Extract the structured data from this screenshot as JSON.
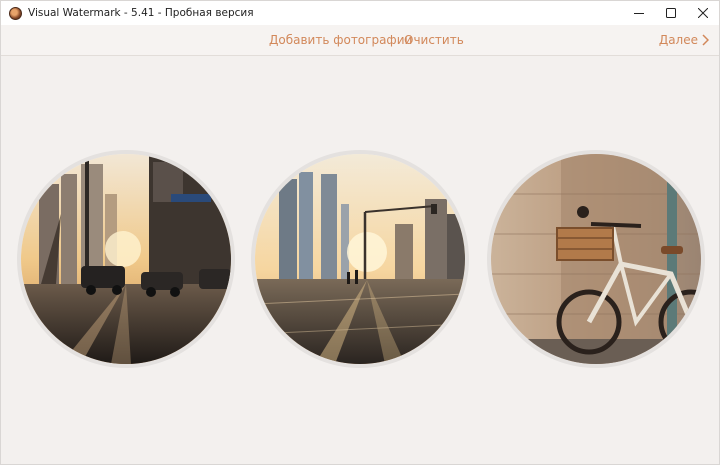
{
  "window": {
    "title": "Visual Watermark - 5.41 - Пробная версия",
    "icons": {
      "app": "app-icon",
      "minimize": "minimize-icon",
      "maximize": "maximize-icon",
      "close": "close-icon"
    }
  },
  "toolbar": {
    "add_photos_label": "Добавить фотографии",
    "clear_label": "Очистить",
    "next_label": "Далее",
    "next_icon": "chevron-right-icon",
    "accent_color": "#d2885a"
  },
  "photos": [
    {
      "name": "city-street-sunset-1"
    },
    {
      "name": "city-street-sunset-2"
    },
    {
      "name": "bicycle-against-wall"
    }
  ]
}
